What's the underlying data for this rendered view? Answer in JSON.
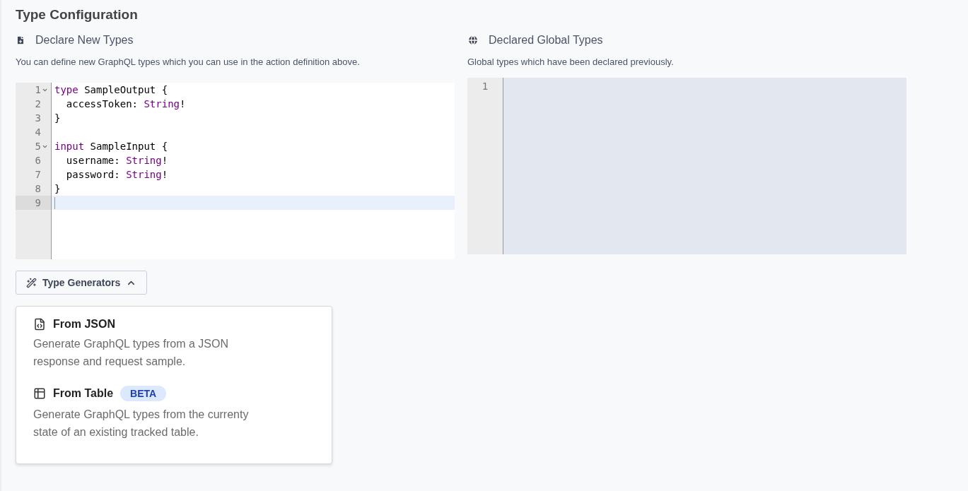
{
  "title": "Type Configuration",
  "declare": {
    "heading": "Declare New Types",
    "description": "You can define new GraphQL types which you can use in the action definition above.",
    "editor": {
      "lines": [
        {
          "number": "1",
          "foldable": true,
          "active": false,
          "tokens": [
            {
              "kind": "keyword",
              "text": "type"
            },
            {
              "kind": "plain",
              "text": " SampleOutput {"
            }
          ]
        },
        {
          "number": "2",
          "foldable": false,
          "active": false,
          "tokens": [
            {
              "kind": "plain",
              "text": "  accessToken: "
            },
            {
              "kind": "type",
              "text": "String"
            },
            {
              "kind": "plain",
              "text": "!"
            }
          ]
        },
        {
          "number": "3",
          "foldable": false,
          "active": false,
          "tokens": [
            {
              "kind": "plain",
              "text": "}"
            }
          ]
        },
        {
          "number": "4",
          "foldable": false,
          "active": false
        },
        {
          "number": "5",
          "foldable": true,
          "active": false,
          "tokens": [
            {
              "kind": "keyword",
              "text": "input"
            },
            {
              "kind": "plain",
              "text": " SampleInput {"
            }
          ]
        },
        {
          "number": "6",
          "foldable": false,
          "active": false,
          "tokens": [
            {
              "kind": "plain",
              "text": "  username: "
            },
            {
              "kind": "type",
              "text": "String"
            },
            {
              "kind": "plain",
              "text": "!"
            }
          ]
        },
        {
          "number": "7",
          "foldable": false,
          "active": false,
          "tokens": [
            {
              "kind": "plain",
              "text": "  password: "
            },
            {
              "kind": "type",
              "text": "String"
            },
            {
              "kind": "plain",
              "text": "!"
            }
          ]
        },
        {
          "number": "8",
          "foldable": false,
          "active": false,
          "tokens": [
            {
              "kind": "plain",
              "text": "}"
            }
          ]
        },
        {
          "number": "9",
          "foldable": false,
          "active": true
        }
      ]
    }
  },
  "global": {
    "heading": "Declared Global Types",
    "description": "Global types which have been declared previously.",
    "editor": {
      "lines": [
        {
          "number": "1"
        }
      ]
    }
  },
  "type_generators": {
    "label": "Type Generators",
    "expanded": true,
    "items": [
      {
        "kind": "json",
        "title": "From JSON",
        "description": "Generate GraphQL types from a JSON response and request sample."
      },
      {
        "kind": "table",
        "title": "From Table",
        "badge": "BETA",
        "description": "Generate GraphQL types from the currenty state of an existing tracked table."
      }
    ]
  }
}
